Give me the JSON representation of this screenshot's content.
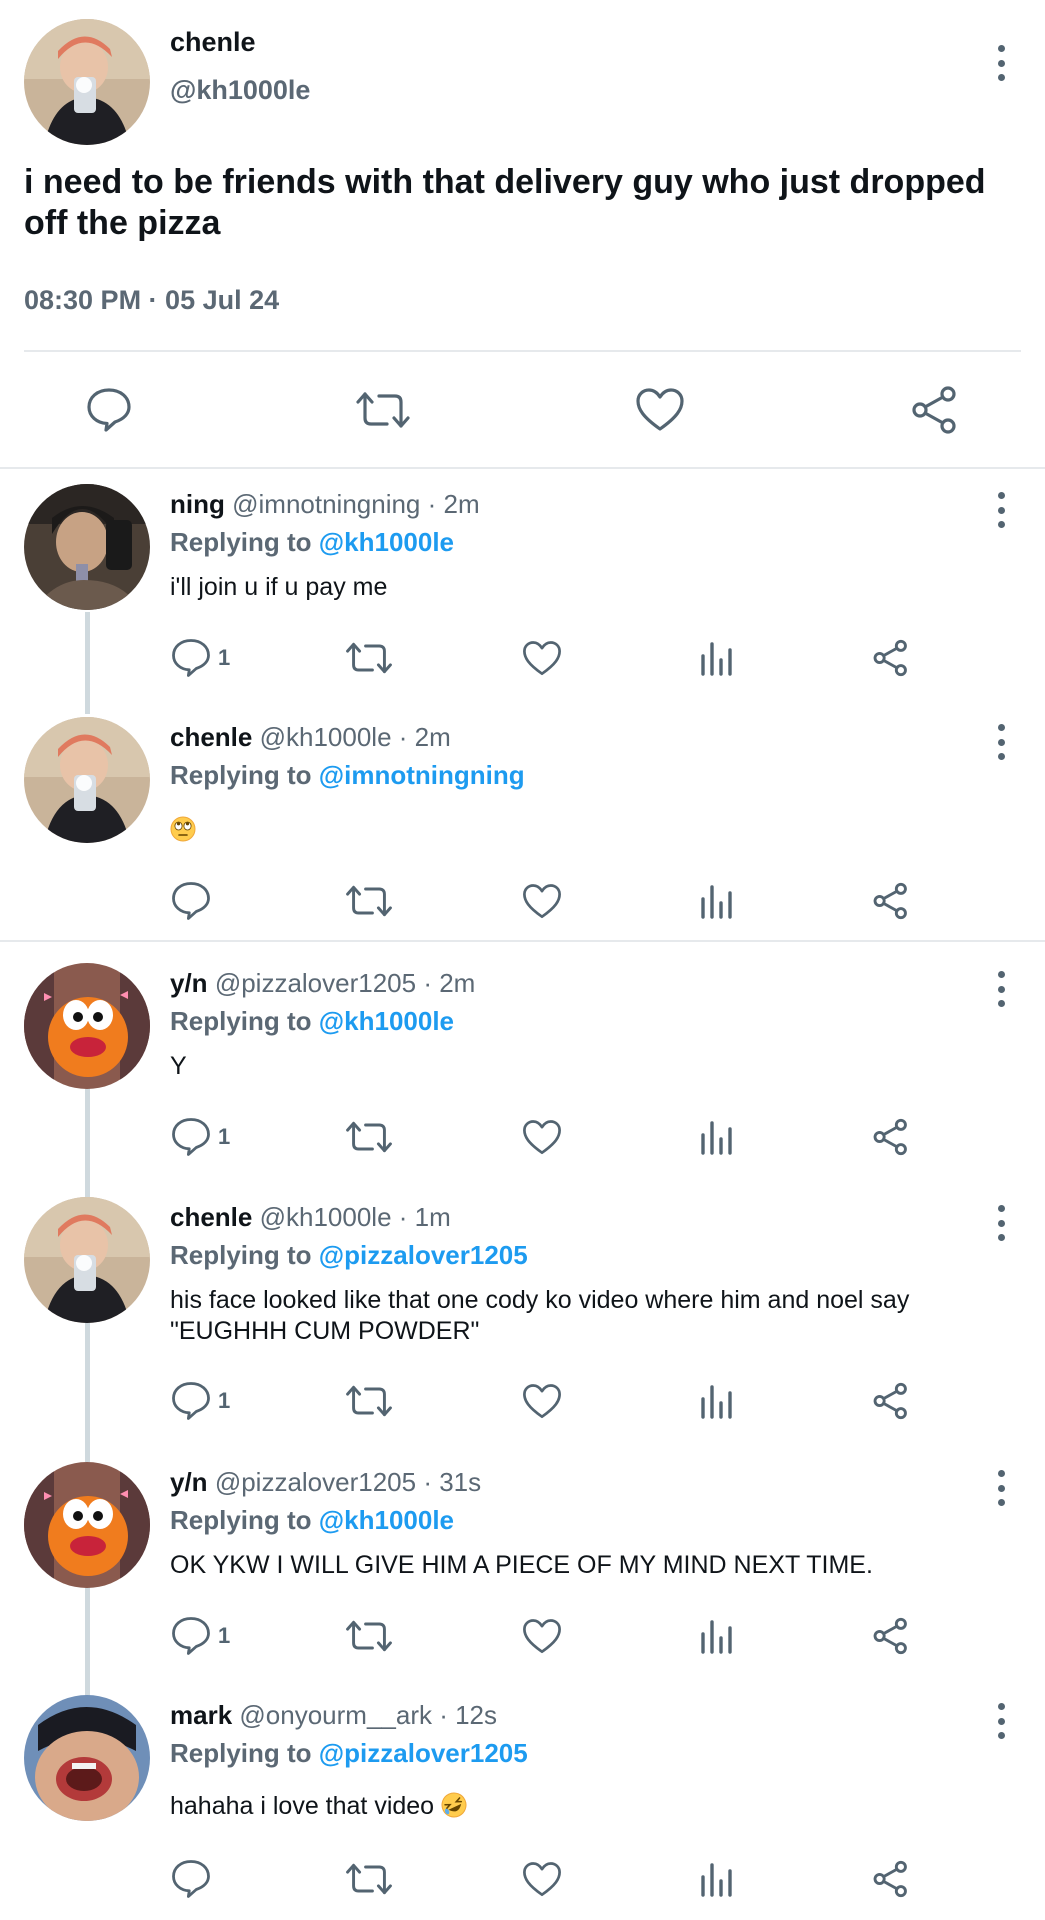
{
  "main_post": {
    "name": "chenle",
    "handle": "@kh1000le",
    "text": "i need to be friends with that delivery guy who just dropped off the pizza",
    "timestamp": "08:30 PM · 05 Jul 24"
  },
  "replies": [
    {
      "name": "ning",
      "meta": "@imnotningning · 2m",
      "replying_label": "Replying to",
      "replying_to": "@kh1000le",
      "text": "i'll join u if u pay me",
      "reply_count": "1"
    },
    {
      "name": "chenle",
      "meta": "@kh1000le · 2m",
      "replying_label": "Replying to",
      "replying_to": "@imnotningning",
      "text": "",
      "emoji": "face-with-rolling-eyes",
      "reply_count": ""
    },
    {
      "name": "y/n",
      "meta": "@pizzalover1205 · 2m",
      "replying_label": "Replying to",
      "replying_to": "@kh1000le",
      "text": "Y",
      "reply_count": "1"
    },
    {
      "name": "chenle",
      "meta": "@kh1000le · 1m",
      "replying_label": "Replying to",
      "replying_to": "@pizzalover1205",
      "text": "his face looked like that one cody ko video where him and noel say \"EUGHHH CUM POWDER\"",
      "reply_count": "1"
    },
    {
      "name": "y/n",
      "meta": "@pizzalover1205 · 31s",
      "replying_label": "Replying to",
      "replying_to": "@kh1000le",
      "text": "OK YKW I WILL GIVE HIM A PIECE OF MY MIND NEXT TIME.",
      "reply_count": "1"
    },
    {
      "name": "mark",
      "meta": "@onyourm__ark · 12s",
      "replying_label": "Replying to",
      "replying_to": "@pizzalover1205",
      "text": "hahaha i love that video",
      "emoji": "rolling-on-the-floor-laughing",
      "reply_count": ""
    }
  ],
  "colors": {
    "link": "#1d9bf0",
    "secondary_text": "#5b6874",
    "icon": "#536471",
    "divider": "#e6e9ec"
  }
}
